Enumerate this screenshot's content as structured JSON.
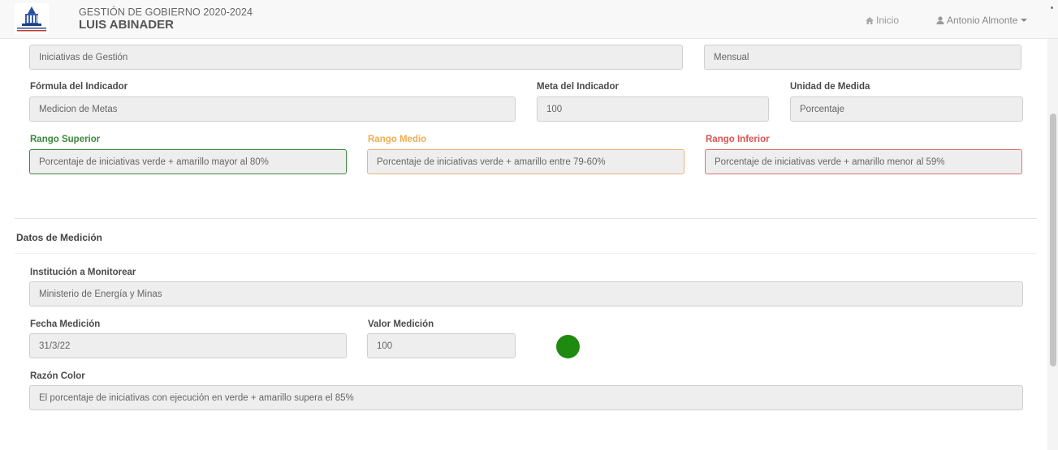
{
  "header": {
    "subtitle": "GESTIÓN DE GOBIERNO 2020-2024",
    "title": "LUIS ABINADER",
    "nav_home": "Inicio",
    "nav_user": "Antonio Almonte"
  },
  "indicator": {
    "row1": {
      "field_left": "Iniciativas de Gestión",
      "field_right": "Mensual"
    },
    "formula": {
      "label": "Fórmula del Indicador",
      "value": "Medicion de Metas"
    },
    "meta": {
      "label": "Meta del Indicador",
      "value": "100"
    },
    "unidad": {
      "label": "Unidad de Medida",
      "value": "Porcentaje"
    },
    "rango_superior": {
      "label": "Rango Superior",
      "value": "Porcentaje de iniciativas verde + amarillo mayor al 80%"
    },
    "rango_medio": {
      "label": "Rango Medio",
      "value": "Porcentaje de iniciativas verde + amarillo entre 79-60%"
    },
    "rango_inferior": {
      "label": "Rango Inferior",
      "value": "Porcentaje de iniciativas verde + amarillo menor al 59%"
    }
  },
  "medicion": {
    "section_title": "Datos de Medición",
    "institucion": {
      "label": "Institución a Monitorear",
      "value": "Ministerio de Energía y Minas"
    },
    "fecha": {
      "label": "Fecha Medición",
      "value": "31/3/22"
    },
    "valor": {
      "label": "Valor Medición",
      "value": "100"
    },
    "status_color": "#1f8a10",
    "razon": {
      "label": "Razón Color",
      "value": "El porcentaje de iniciativas con ejecución en verde + amarillo supera el 85%"
    }
  },
  "icons": {
    "home": "home-icon",
    "user": "user-icon",
    "caret": "caret-down-icon"
  },
  "colors": {
    "green": "#3c8a3c",
    "orange": "#f0ad4e",
    "red": "#d9534f"
  }
}
